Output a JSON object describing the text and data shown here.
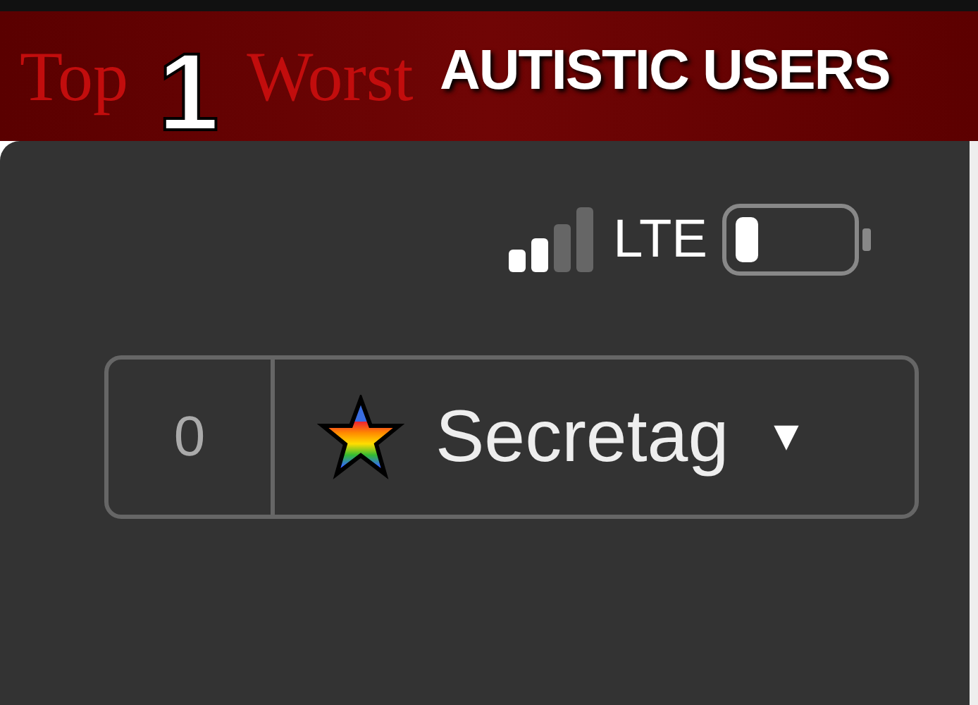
{
  "banner": {
    "faded_words": [
      "Top",
      "Worst"
    ],
    "rank": "1",
    "caption": "AUTISTIC USERS"
  },
  "status_bar": {
    "network": "LTE"
  },
  "user_selector": {
    "count": "0",
    "username": "Secretag",
    "caret": "▼"
  }
}
